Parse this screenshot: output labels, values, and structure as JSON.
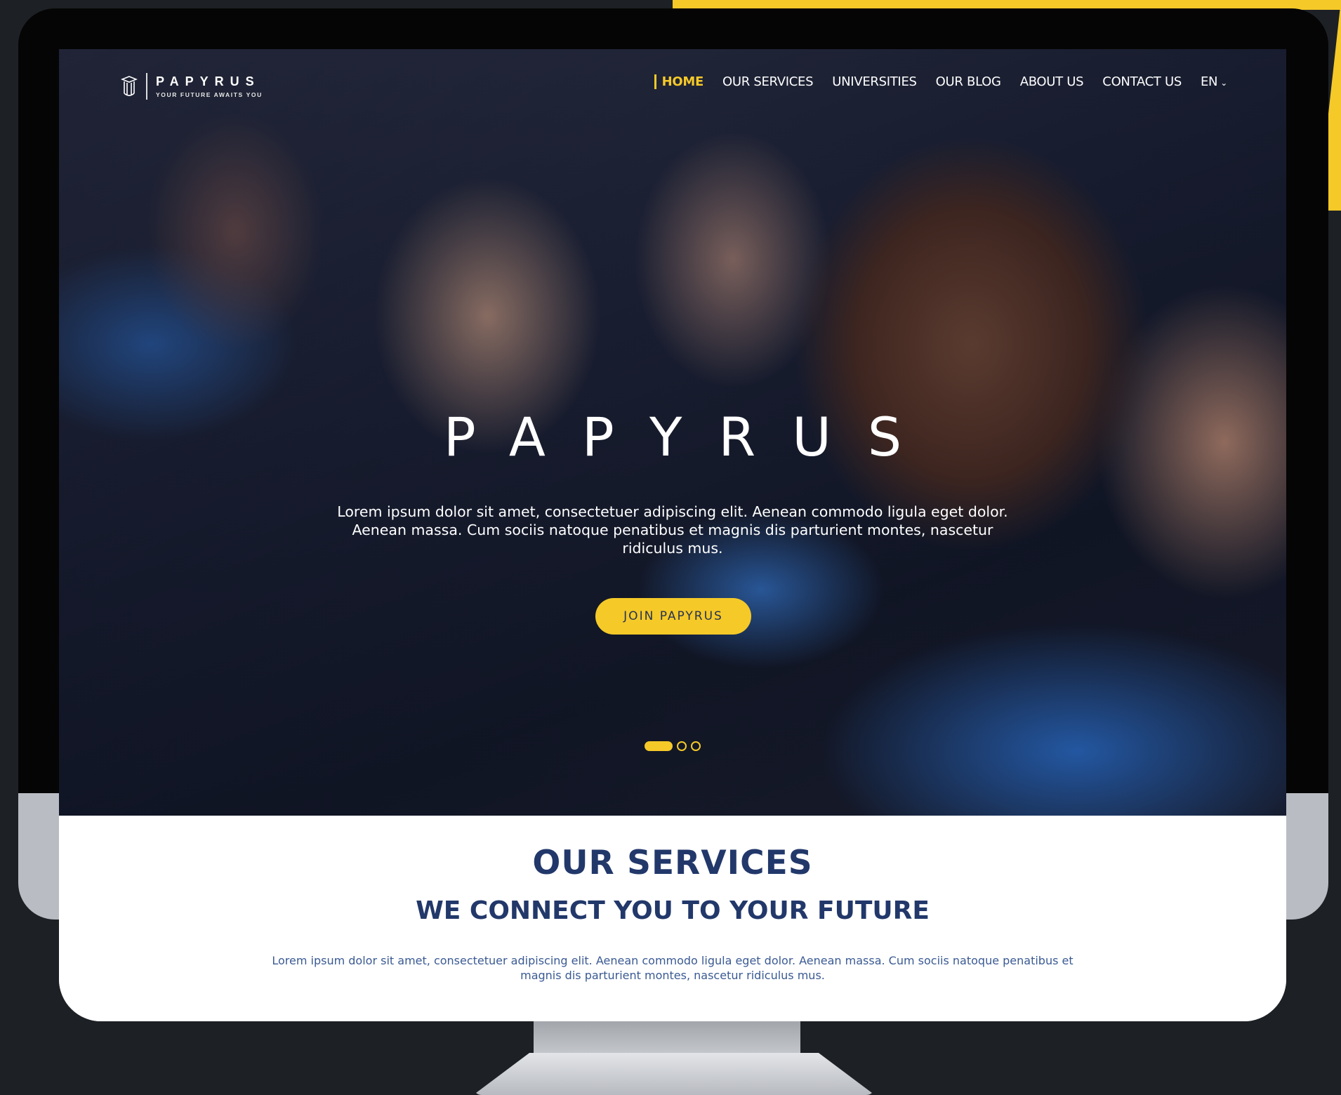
{
  "brand": {
    "name": "PAPYRUS",
    "tagline": "YOUR FUTURE AWAITS YOU"
  },
  "nav": {
    "items": [
      {
        "label": "HOME",
        "active": true
      },
      {
        "label": "OUR SERVICES",
        "active": false
      },
      {
        "label": "UNIVERSITIES",
        "active": false
      },
      {
        "label": "OUR BLOG",
        "active": false
      },
      {
        "label": "ABOUT US",
        "active": false
      },
      {
        "label": "CONTACT US",
        "active": false
      }
    ],
    "language": "EN"
  },
  "hero": {
    "title": "PAPYRUS",
    "text": "Lorem ipsum dolor sit amet, consectetuer adipiscing elit. Aenean commodo ligula eget dolor. Aenean massa. Cum sociis natoque penatibus et magnis dis parturient montes, nascetur ridiculus mus.",
    "button_label": "JOIN PAPYRUS",
    "slides_total": 3,
    "active_slide": 1
  },
  "services": {
    "title": "OUR SERVICES",
    "subtitle": "WE CONNECT YOU TO YOUR FUTURE",
    "text": "Lorem ipsum dolor sit amet, consectetuer adipiscing elit. Aenean commodo ligula eget dolor. Aenean massa. Cum sociis natoque penatibus et magnis dis parturient montes, nascetur ridiculus mus."
  },
  "colors": {
    "accent": "#f5c928",
    "navy": "#22386a",
    "background": "#1d2125"
  }
}
